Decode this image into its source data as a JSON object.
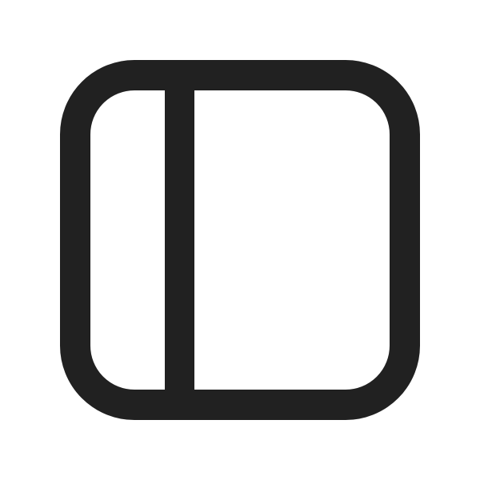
{
  "icon": {
    "name": "sidebar-panel-left-icon",
    "stroke_color": "#212121",
    "background_color": "#ffffff"
  }
}
